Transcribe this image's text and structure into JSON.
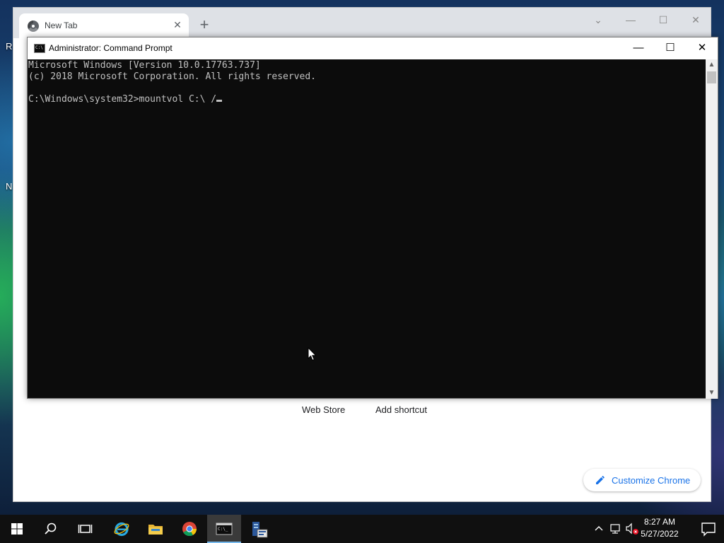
{
  "desktop": {
    "icon_fragments": [
      "R",
      "N"
    ]
  },
  "chrome": {
    "tab_title": "New Tab",
    "tab_close": "✕",
    "new_tab": "+",
    "controls": {
      "dropdown": "⌄",
      "minimize": "—",
      "maximize": "☐",
      "close": "✕"
    },
    "shortcuts": [
      "Web Store",
      "Add shortcut"
    ],
    "customize_label": "Customize Chrome"
  },
  "cmd": {
    "title": "Administrator: Command Prompt",
    "icon_text": "C:\\",
    "controls": {
      "minimize": "—",
      "maximize": "☐",
      "close": "✕"
    },
    "lines": [
      "Microsoft Windows [Version 10.0.17763.737]",
      "(c) 2018 Microsoft Corporation. All rights reserved.",
      "",
      "C:\\Windows\\system32>mountvol C:\\ /"
    ]
  },
  "taskbar": {
    "items": [
      "start-button",
      "search-button",
      "task-view-button",
      "internet-explorer",
      "file-explorer",
      "chrome",
      "command-prompt",
      "server-manager"
    ],
    "clock_time": "8:27 AM",
    "clock_date": "5/27/2022"
  },
  "colors": {
    "taskbar_bg": "#101010",
    "accent": "#1a73e8",
    "cmd_bg": "#0c0c0c",
    "cmd_text": "#c0c0c0"
  }
}
